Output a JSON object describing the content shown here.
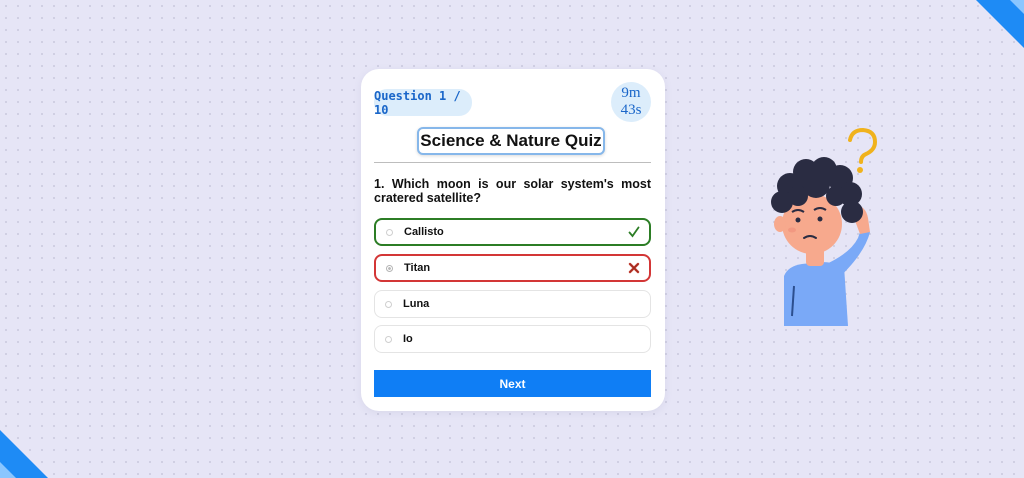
{
  "quiz": {
    "question_counter": "Question 1 / 10",
    "timer_minutes": "9m",
    "timer_seconds": "43s",
    "title": "Science & Nature Quiz",
    "question_text": "1. Which moon is our solar system's most cratered satellite?",
    "options": [
      {
        "label": "Callisto",
        "state": "correct"
      },
      {
        "label": "Titan",
        "state": "wrong-selected"
      },
      {
        "label": "Luna",
        "state": "neutral"
      },
      {
        "label": "Io",
        "state": "neutral"
      }
    ],
    "next_label": "Next"
  },
  "icons": {
    "correct": "check-icon",
    "wrong": "cross-icon",
    "illustration": "confused-boy-question-mark"
  },
  "colors": {
    "accent": "#0f7ef5",
    "correct": "#2c7d25",
    "wrong": "#d33636",
    "badge_bg": "#dcedfb",
    "background": "#e6e5f6"
  }
}
